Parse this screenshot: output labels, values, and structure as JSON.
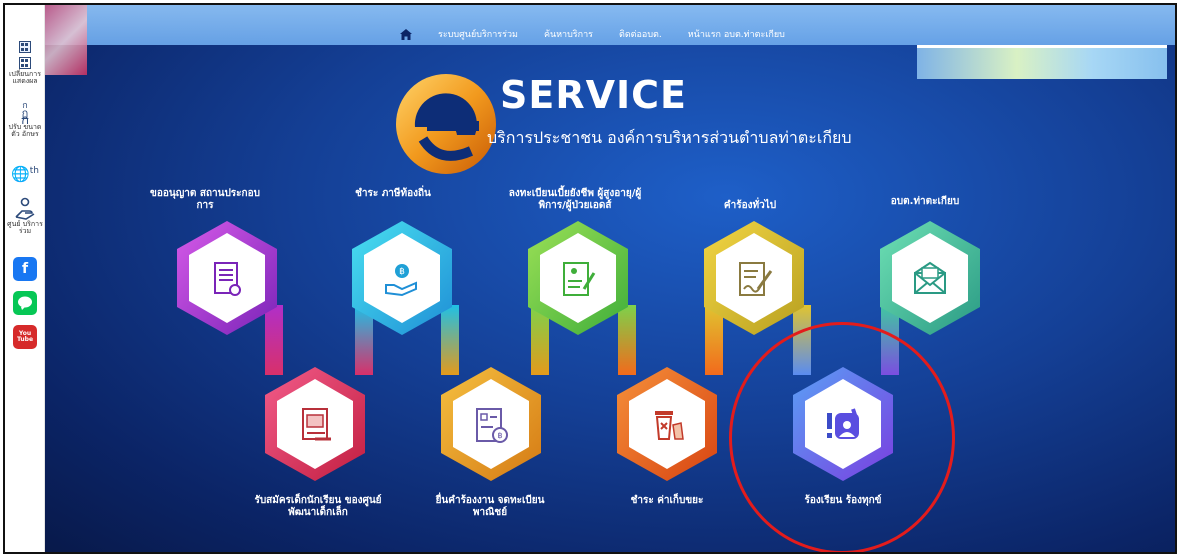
{
  "sidebar": {
    "display_label": "เปลี่ยนการ แสดงผล",
    "font_size_label": "ปรับ ขนาดตัว อักษร",
    "lang_label": "th",
    "center_label": "ศูนย์ บริการร่วม",
    "facebook_label": "f",
    "youtube_label": "You Tube"
  },
  "nav": {
    "items": [
      "ระบบศูนย์บริการร่วม",
      "ค้นหาบริการ",
      "ติดต่ออบต.",
      "หน้าแรก อบต.ท่าตะเกียบ"
    ]
  },
  "header": {
    "brand": "SERVICE",
    "subtitle": "บริการประชาชน องค์การบริหารส่วนตำบลท่าตะเกียบ"
  },
  "services": [
    {
      "label": "ขออนุญาต สถานประกอบการ",
      "icon": "document-icon"
    },
    {
      "label": "ชำระ ภาษีท้องถิ่น",
      "icon": "hand-coin-icon"
    },
    {
      "label": "ลงทะเบียนเบี้ยยังชีพ ผู้สูงอายุ/ผู้พิการ/ผู้ป่วยเอดส์",
      "icon": "register-form-icon"
    },
    {
      "label": "คำร้องทั่วไป",
      "icon": "writing-form-icon"
    },
    {
      "label": "อบต.ท่าตะเกียบ",
      "icon": "mail-icon"
    },
    {
      "label": "รับสมัครเด็กนักเรียน ของศูนย์พัฒนาเด็กเล็ก",
      "icon": "school-icon"
    },
    {
      "label": "ยื่นคำร้องงาน จดทะเบียนพาณิชย์",
      "icon": "commerce-doc-icon"
    },
    {
      "label": "ชำระ ค่าเก็บขยะ",
      "icon": "trash-icon"
    },
    {
      "label": "ร้องเรียน ร้องทุกข์",
      "icon": "complaint-icon"
    }
  ],
  "colors": {
    "accent": "#e31c1c",
    "bg_deep": "#0b2466",
    "bg_bright": "#1e5fc8"
  }
}
